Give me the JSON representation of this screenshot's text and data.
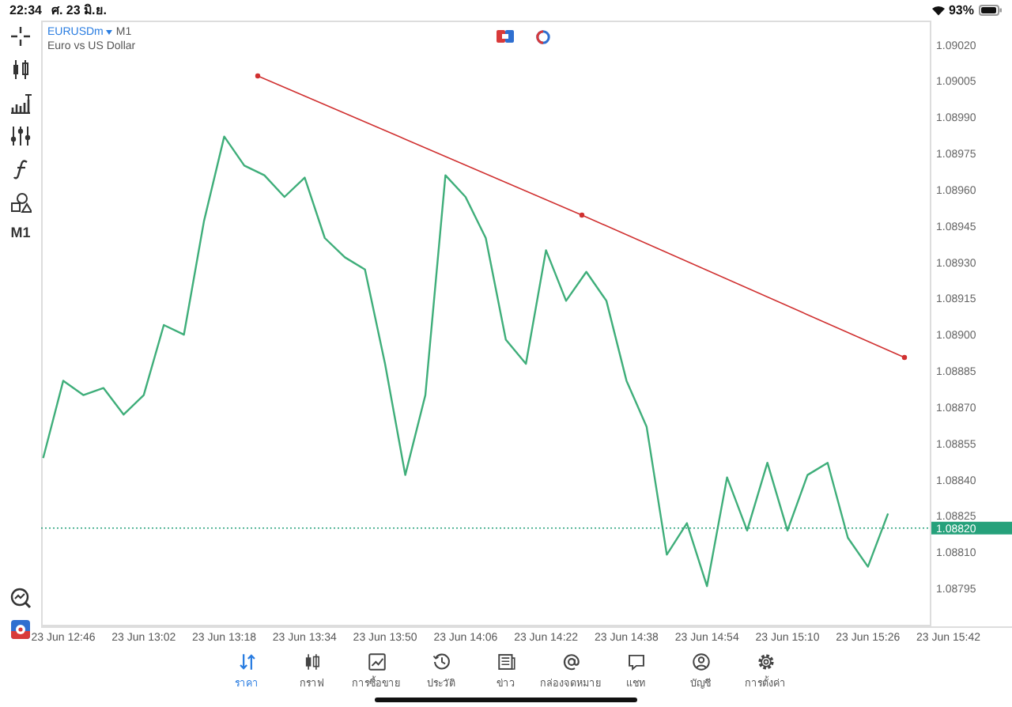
{
  "status_bar": {
    "time": "22:34",
    "date": "ศ. 23 มิ.ย.",
    "battery": "93%"
  },
  "chart_header": {
    "symbol": "EURUSDm",
    "timeframe": "M1",
    "description": "Euro vs US Dollar"
  },
  "toolbar": {
    "timeframe": "M1"
  },
  "chart": {
    "chart_data": {
      "type": "line",
      "ylim": [
        1.0878,
        1.0903
      ],
      "categories": [
        null,
        "23 Jun 12:46",
        null,
        null,
        null,
        "23 Jun 13:02",
        null,
        null,
        null,
        "23 Jun 13:18",
        null,
        null,
        null,
        "23 Jun 13:34",
        null,
        null,
        null,
        "23 Jun 13:50",
        null,
        null,
        null,
        "23 Jun 14:06",
        null,
        null,
        null,
        "23 Jun 14:22",
        null,
        null,
        null,
        "23 Jun 14:38",
        null,
        null,
        null,
        "23 Jun 14:54",
        null,
        null,
        null,
        "23 Jun 15:10",
        null,
        null,
        null,
        "23 Jun 15:26",
        null,
        null,
        null,
        "23 Jun 15:42"
      ],
      "series": [
        {
          "color": "#3fae7a",
          "values": [
            1.08849,
            1.08881,
            1.08875,
            1.08878,
            1.08867,
            1.08875,
            1.08904,
            1.089,
            1.08947,
            1.08982,
            1.0897,
            1.08966,
            1.08957,
            1.08965,
            1.0894,
            1.08932,
            1.08927,
            1.08888,
            1.08842,
            1.08875,
            1.08966,
            1.08957,
            1.0894,
            1.08898,
            1.08888,
            1.08935,
            1.08914,
            1.08926,
            1.08914,
            1.08881,
            1.08862,
            1.08809,
            1.08822,
            1.08796,
            1.08841,
            1.08819,
            1.08847,
            1.08819,
            1.08842,
            1.08847,
            1.08816,
            1.08804,
            1.08826,
            null,
            null,
            null
          ]
        }
      ],
      "yticks": [
        {
          "value": 1.0902,
          "label": "1.09020"
        },
        {
          "value": 1.09005,
          "label": "1.09005"
        },
        {
          "value": 1.0899,
          "label": "1.08990"
        },
        {
          "value": 1.08975,
          "label": "1.08975"
        },
        {
          "value": 1.0896,
          "label": "1.08960"
        },
        {
          "value": 1.08945,
          "label": "1.08945"
        },
        {
          "value": 1.0893,
          "label": "1.08930"
        },
        {
          "value": 1.08915,
          "label": "1.08915"
        },
        {
          "value": 1.089,
          "label": "1.08900"
        },
        {
          "value": 1.08885,
          "label": "1.08885"
        },
        {
          "value": 1.0887,
          "label": "1.08870"
        },
        {
          "value": 1.08855,
          "label": "1.08855"
        },
        {
          "value": 1.0884,
          "label": "1.08840"
        },
        {
          "value": 1.08825,
          "label": "1.08825"
        },
        {
          "value": 1.0881,
          "label": "1.08810"
        },
        {
          "value": 1.08795,
          "label": "1.08795"
        }
      ]
    },
    "current_price": "1.08820"
  },
  "bottom_nav": [
    {
      "label": "ราคา",
      "selected": true
    },
    {
      "label": "กราฟ",
      "selected": false
    },
    {
      "label": "การซื้อขาย",
      "selected": false
    },
    {
      "label": "ประวัติ",
      "selected": false
    },
    {
      "label": "ข่าว",
      "selected": false
    },
    {
      "label": "กล่องจดหมาย",
      "selected": false
    },
    {
      "label": "แชท",
      "selected": false
    },
    {
      "label": "บัญชี",
      "selected": false
    },
    {
      "label": "การตั้งค่า",
      "selected": false
    }
  ]
}
